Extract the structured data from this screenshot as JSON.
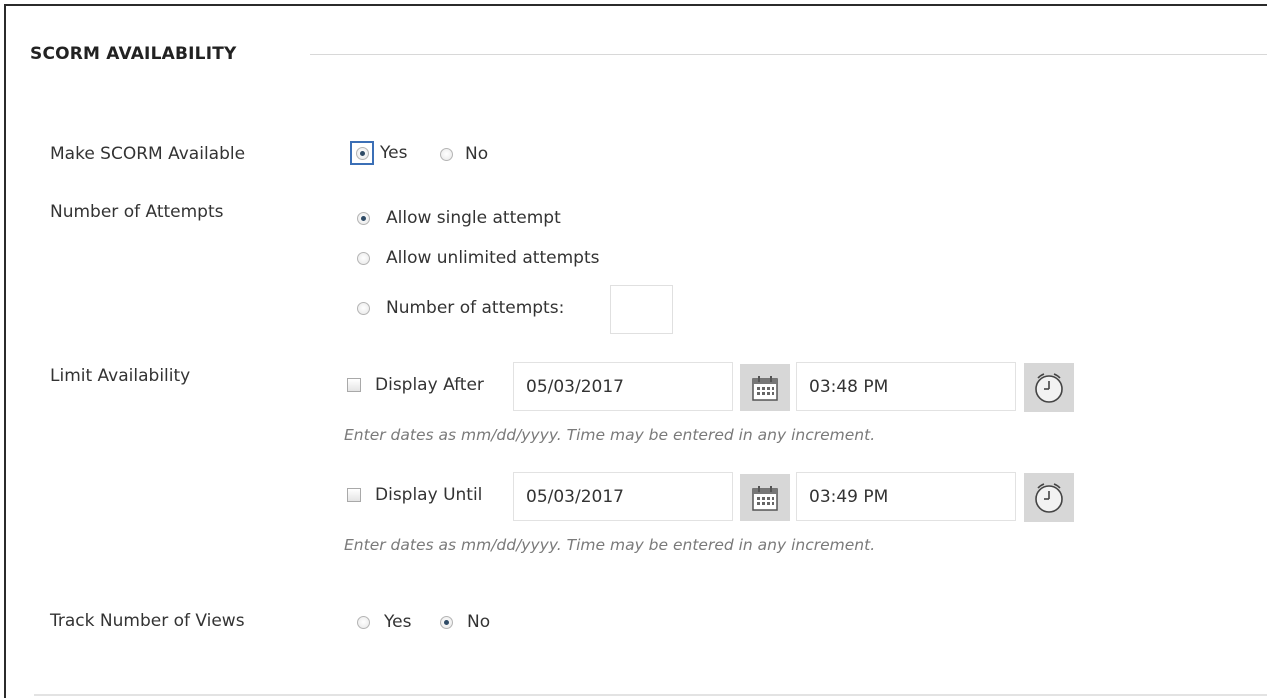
{
  "section": {
    "title": "SCORM AVAILABILITY"
  },
  "make_available": {
    "label": "Make SCORM Available",
    "yes_label": "Yes",
    "no_label": "No",
    "selected": "Yes"
  },
  "attempts": {
    "label": "Number of Attempts",
    "options": [
      "Allow single attempt",
      "Allow unlimited attempts",
      "Number of attempts:"
    ],
    "selected": "Allow single attempt",
    "count_value": ""
  },
  "limit": {
    "label": "Limit Availability",
    "after": {
      "label": "Display After",
      "checked": false,
      "date": "05/03/2017",
      "time": "03:48 PM",
      "help": "Enter dates as mm/dd/yyyy. Time may be entered in any increment."
    },
    "until": {
      "label": "Display Until",
      "checked": false,
      "date": "05/03/2017",
      "time": "03:49 PM",
      "help": "Enter dates as mm/dd/yyyy. Time may be entered in any increment."
    }
  },
  "track_views": {
    "label": "Track Number of Views",
    "yes_label": "Yes",
    "no_label": "No",
    "selected": "No"
  },
  "icons": {
    "calendar": "calendar-icon",
    "clock": "clock-icon"
  },
  "colors": {
    "focus_ring": "#3b6fb6",
    "radio_dot": "#2f4b66",
    "icon_bg": "#d7d7d7"
  }
}
